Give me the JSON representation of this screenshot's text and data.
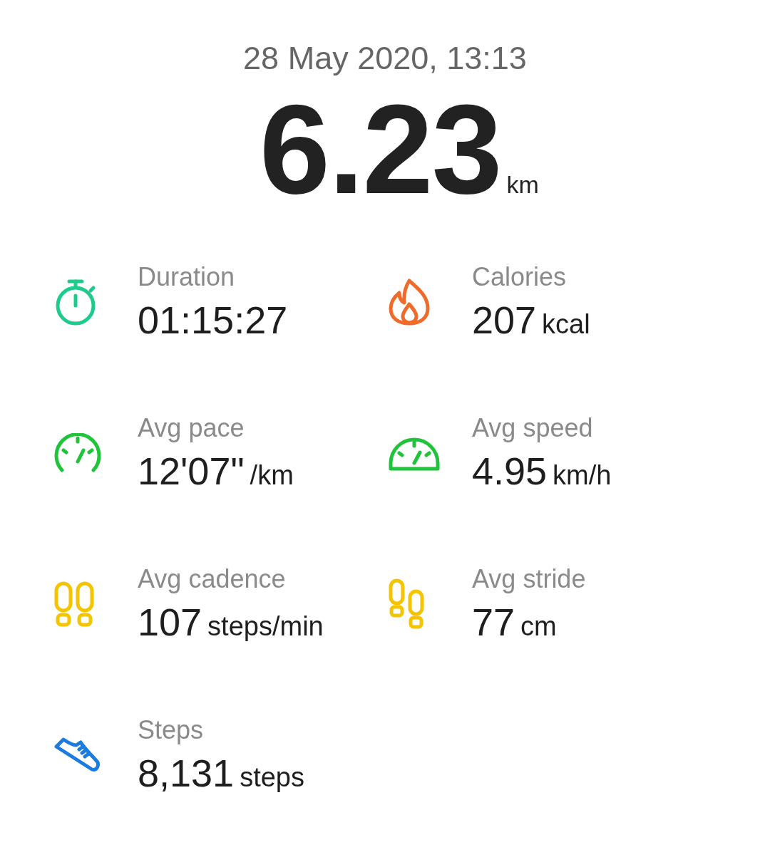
{
  "date": "28 May 2020, 13:13",
  "distance": {
    "value": "6.23",
    "unit": "km"
  },
  "stats": [
    {
      "kind": "stopwatch",
      "label": "Duration",
      "value": "01:15:27"
    },
    {
      "kind": "flame",
      "label": "Calories",
      "value": "207",
      "unit": "kcal"
    },
    {
      "kind": "pace",
      "label": "Avg pace",
      "value": "12'07\"",
      "unit": "/km"
    },
    {
      "kind": "speed",
      "label": "Avg speed",
      "value": "4.95",
      "unit": "km/h"
    },
    {
      "kind": "cadence",
      "label": "Avg cadence",
      "value": "107",
      "unit": "steps/min"
    },
    {
      "kind": "stride",
      "label": "Avg stride",
      "value": "77",
      "unit": "cm"
    },
    {
      "kind": "shoe",
      "label": "Steps",
      "value": "8,131",
      "unit": "steps"
    }
  ]
}
